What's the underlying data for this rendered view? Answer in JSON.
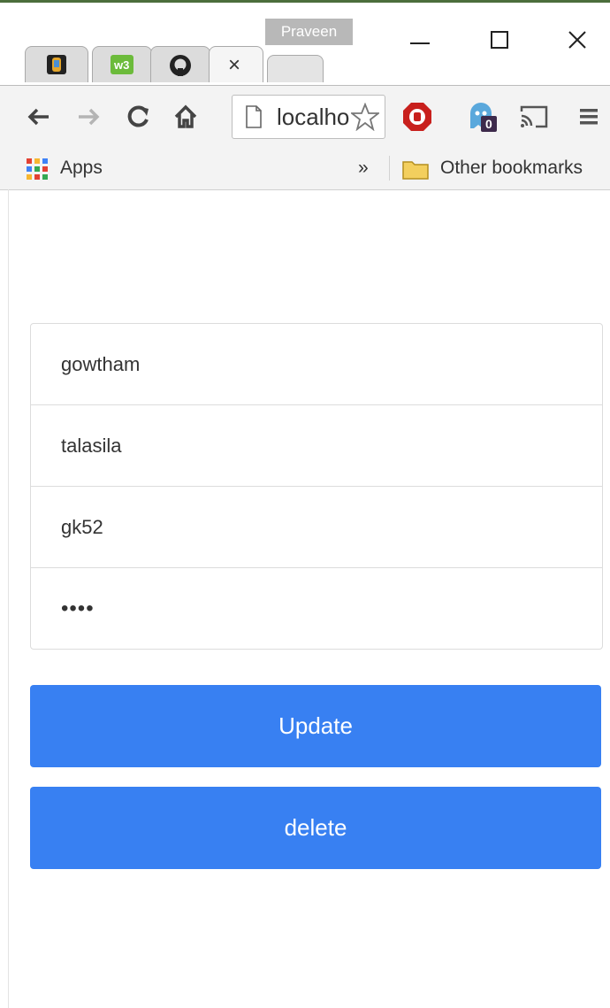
{
  "browser": {
    "profile_name": "Praveen",
    "tab_close": "×",
    "url": "localhost",
    "bookmarks": {
      "apps_label": "Apps",
      "overflow": "»",
      "other_label": "Other bookmarks"
    },
    "extensions": {
      "ghostery_count": "0"
    }
  },
  "form": {
    "fields": [
      {
        "value": "gowtham"
      },
      {
        "value": "talasila"
      },
      {
        "value": "gk52"
      },
      {
        "value": "••••"
      }
    ],
    "update_label": "Update",
    "delete_label": "delete"
  },
  "colors": {
    "button_bg": "#3880f2",
    "button_text": "#ffffff"
  }
}
